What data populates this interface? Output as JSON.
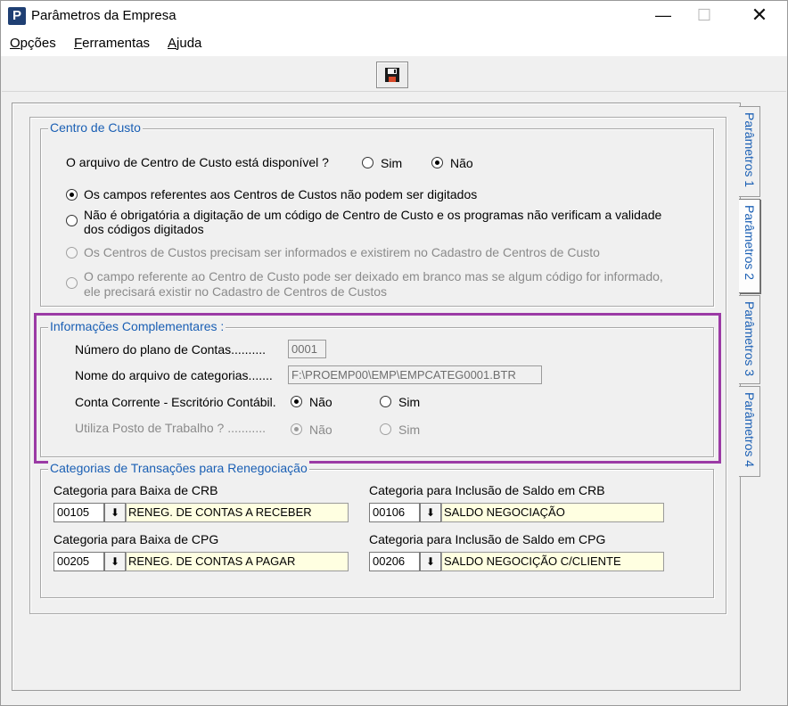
{
  "window": {
    "title": "Parâmetros da Empresa",
    "app_icon_letter": "P",
    "minimize_glyph": "—",
    "maximize_glyph": "☐",
    "close_glyph": "✕"
  },
  "menu": [
    {
      "accel": "O",
      "rest": "pções"
    },
    {
      "accel": "F",
      "rest": "erramentas"
    },
    {
      "accel": "A",
      "rest": "juda"
    }
  ],
  "toolbar": {
    "save_icon": "floppy-disk-icon"
  },
  "tabs": [
    "Parâmetros 1",
    "Parâmetros 2",
    "Parâmetros 3",
    "Parâmetros 4"
  ],
  "active_tab": "Parâmetros 2",
  "centro_custo": {
    "title": "Centro de Custo",
    "question": "O arquivo de  Centro de Custo  está disponível ?",
    "opt_sim": "Sim",
    "opt_nao": "Não",
    "selected": "Não",
    "options": [
      "Os campos referentes aos Centros de Custos não podem ser digitados",
      "Não é obrigatória a digitação de um código de Centro de Custo e os programas não verificam a validade",
      "dos códigos digitados",
      "Os Centros de Custos precisam ser informados e existirem no Cadastro de Centros de Custo",
      "O campo referente ao Centro de Custo pode ser deixado em branco mas se algum código for informado,",
      "ele precisará existir no Cadastro de Centros de Custos"
    ]
  },
  "info_comp": {
    "title": "Informações Complementares :",
    "plano_label": "Número do plano de Contas..........",
    "plano_value": "0001",
    "arquivo_label": "Nome do arquivo de categorias.......",
    "arquivo_value": "F:\\PROEMP00\\EMP\\EMPCATEG0001.BTR",
    "conta_label": "Conta Corrente - Escritório Contábil.",
    "conta_nao": "Não",
    "conta_sim": "Sim",
    "conta_selected": "Não",
    "posto_label": "Utiliza Posto de Trabalho ? ...........",
    "posto_nao": "Não",
    "posto_sim": "Sim",
    "posto_selected": "Não"
  },
  "categorias": {
    "title": "Categorias de Transações para Renegociação",
    "baixa_crb_label": "Categoria para Baixa de CRB",
    "baixa_crb_code": "00105",
    "baixa_crb_desc": "RENEG. DE CONTAS A RECEBER",
    "incl_crb_label": "Categoria para Inclusão de Saldo em CRB",
    "incl_crb_code": "00106",
    "incl_crb_desc": "SALDO NEGOCIAÇÃO",
    "baixa_cpg_label": "Categoria para Baixa de CPG",
    "baixa_cpg_code": "00205",
    "baixa_cpg_desc": "RENEG. DE CONTAS A PAGAR",
    "incl_cpg_label": "Categoria para Inclusão de Saldo em CPG",
    "incl_cpg_code": "00206",
    "incl_cpg_desc": "SALDO NEGOCIÇÃO C/CLIENTE",
    "lookup_glyph": "⬇"
  },
  "colors": {
    "group_title": "#1a5fb4",
    "highlight_border": "#9b3aa5",
    "desc_field_bg": "#ffffe1"
  }
}
